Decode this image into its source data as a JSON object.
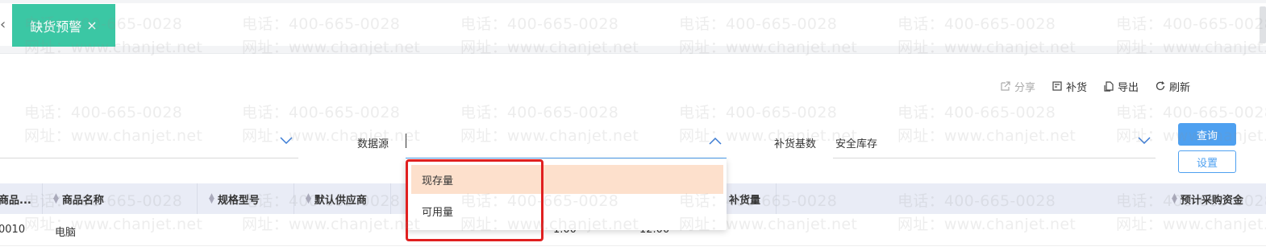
{
  "tab": {
    "prev_arrow": "‹",
    "title": "缺货预警",
    "close": "×"
  },
  "watermark": {
    "line1": "电话：400-665-0028",
    "line2": "网址：www.chanjet.net"
  },
  "toolbar": {
    "share": "分享",
    "replenish": "补货",
    "export": "导出",
    "refresh": "刷新"
  },
  "filters": {
    "datasource_label": "数据源",
    "basis_label": "补货基数",
    "basis_value": "安全库存",
    "query_button": "查询",
    "settings_button": "设置"
  },
  "dropdown": {
    "options": [
      "现存量",
      "可用量"
    ],
    "selected_index": 0
  },
  "table": {
    "columns": [
      "商品...",
      "商品名称",
      "规格型号",
      "默认供应商",
      "补货量",
      "预计采购资金"
    ],
    "row": {
      "code": "0010",
      "name": "电脑",
      "col_a": "1.00",
      "col_b": "12.00"
    }
  },
  "colors": {
    "tab_active": "#3bc7a4",
    "primary": "#4ea0f0",
    "highlight": "#e02020",
    "selected_option": "#fde0cc"
  }
}
